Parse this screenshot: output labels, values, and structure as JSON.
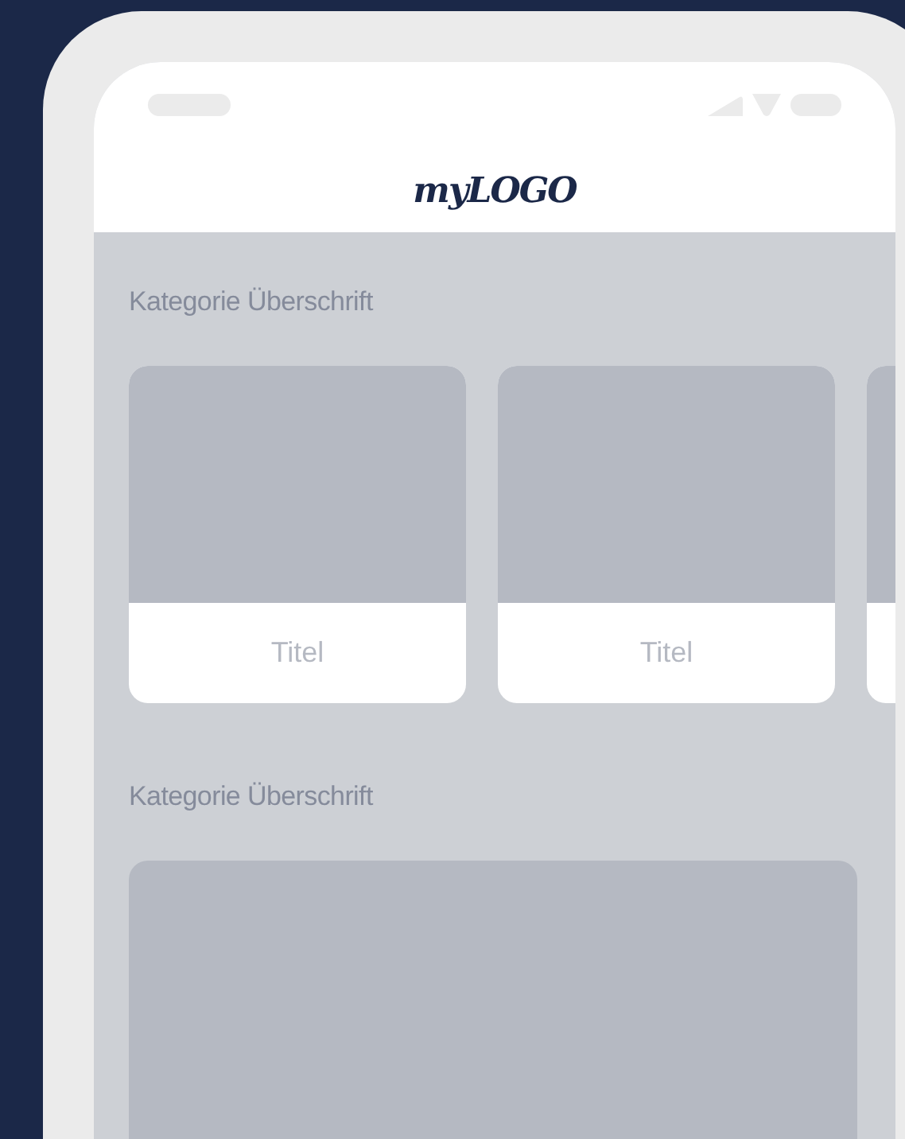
{
  "header": {
    "logo": "myLOGO"
  },
  "sections": [
    {
      "heading": "Kategorie Überschrift",
      "kind": "carousel",
      "cards": [
        {
          "kind": "titled",
          "title": "Titel"
        },
        {
          "kind": "titled",
          "title": "Titel"
        },
        {
          "kind": "plain"
        }
      ]
    },
    {
      "heading": "Kategorie Überschrift",
      "kind": "banner",
      "cards": [
        {
          "kind": "plain"
        }
      ]
    }
  ]
}
